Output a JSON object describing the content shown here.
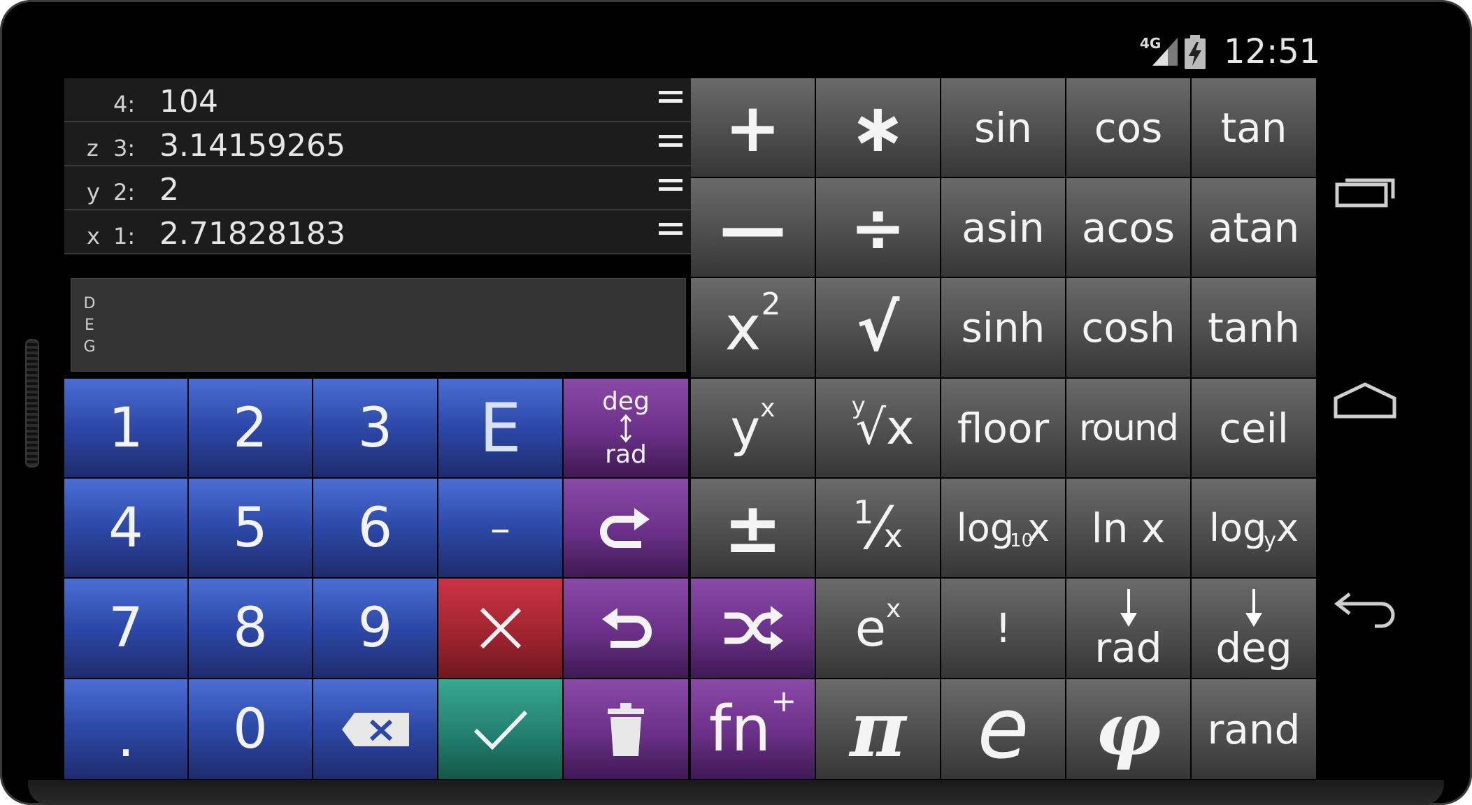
{
  "status_bar": {
    "network": "4G",
    "time": "12:51"
  },
  "stack": [
    {
      "var": "",
      "level": "4:",
      "value": "104"
    },
    {
      "var": "z",
      "level": "3:",
      "value": "3.14159265"
    },
    {
      "var": "y",
      "level": "2:",
      "value": "2"
    },
    {
      "var": "x",
      "level": "1:",
      "value": "2.71828183"
    }
  ],
  "input": {
    "angle_mode": [
      "D",
      "E",
      "G"
    ]
  },
  "keys": {
    "digits": {
      "one": "1",
      "two": "2",
      "three": "3",
      "four": "4",
      "five": "5",
      "six": "6",
      "seven": "7",
      "eight": "8",
      "nine": "9",
      "zero": "0",
      "dot": "."
    },
    "exp": "E",
    "neg": "–",
    "deg_rad_top": "deg",
    "deg_rad_bottom": "rad",
    "plus": "+",
    "times": "∗",
    "minus": "—",
    "divide": "÷",
    "sqr_base": "x",
    "sqr_exp": "2",
    "sqrt": "√",
    "pow_base": "y",
    "pow_exp": "x",
    "root_index": "y",
    "root_sym": "√x",
    "plusminus": "±",
    "recip_num": "1",
    "recip_den": "x",
    "ex_base": "e",
    "ex_exp": "x",
    "fact": "!",
    "pi": "π",
    "e_const": "e",
    "phi": "φ",
    "rand": "rand",
    "sin": "sin",
    "cos": "cos",
    "tan": "tan",
    "asin": "asin",
    "acos": "acos",
    "atan": "atan",
    "sinh": "sinh",
    "cosh": "cosh",
    "tanh": "tanh",
    "floor": "floor",
    "round": "round",
    "ceil": "ceil",
    "log10_main": "log",
    "log10_sub": "10",
    "log10_x": "x",
    "ln": "ln x",
    "logy_main": "log",
    "logy_sub": "y",
    "logy_x": "x",
    "to_rad": "rad",
    "to_deg": "deg",
    "fn_label": "fn",
    "fn_plus": "+"
  },
  "colors": {
    "digit_keys": "#2c48a8",
    "stack_ops": "#6a3088",
    "function_keys": "#4e4e4e",
    "clear_key": "#a22430",
    "enter_key": "#238070"
  }
}
